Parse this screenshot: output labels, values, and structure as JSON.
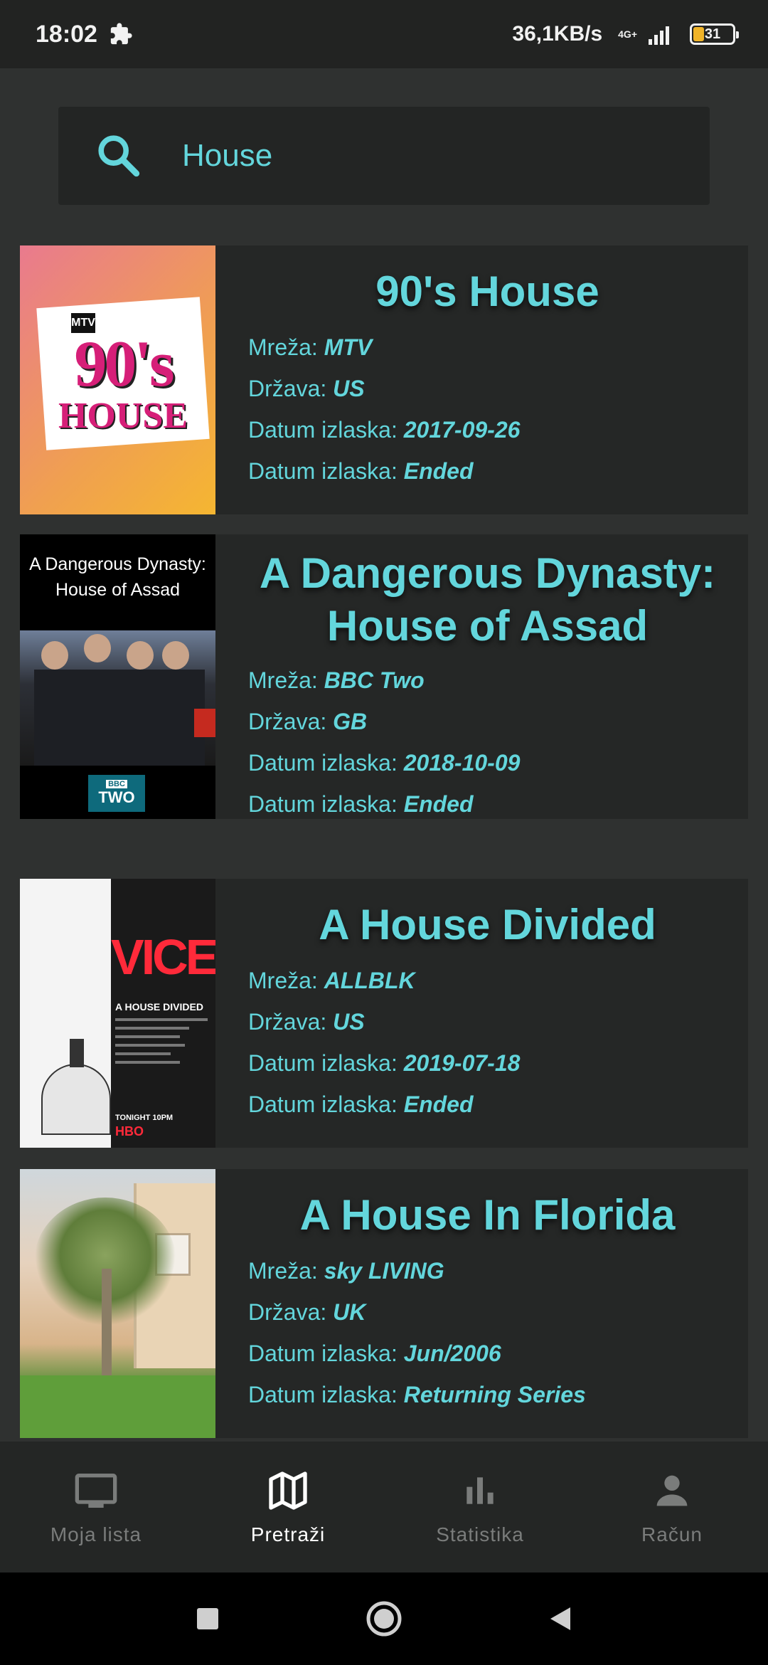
{
  "status": {
    "time": "18:02",
    "speed": "36,1KB/s",
    "net_type": "4G+",
    "battery": "31"
  },
  "search": {
    "value": "House",
    "placeholder": ""
  },
  "fields": {
    "network": "Mreža: ",
    "country": "Država: ",
    "release": "Datum izlaska: ",
    "status": "Datum izlaska: "
  },
  "shows": [
    {
      "title": "90's House",
      "network": "MTV",
      "country": "US",
      "release": "2017-09-26",
      "status": "Ended",
      "poster": {
        "line1": "90's",
        "line2": "HOUSE",
        "badge": "MTV"
      }
    },
    {
      "title": "A Dangerous Dynasty: House of Assad",
      "network": "BBC Two",
      "country": "GB",
      "release": "2018-10-09",
      "status": "Ended",
      "poster": {
        "caption": "A Dangerous Dynasty: House of Assad",
        "badge_top": "BBC",
        "badge_bottom": "TWO"
      }
    },
    {
      "title": "A House Divided",
      "network": "ALLBLK",
      "country": "US",
      "release": "2019-07-18",
      "status": "Ended",
      "poster": {
        "brand": "VICE",
        "sub": "A HOUSE DIVIDED",
        "bottom": "TONIGHT 10PM",
        "channel": "HBO"
      }
    },
    {
      "title": "A House In Florida",
      "network": "sky LIVING",
      "country": "UK",
      "release": "Jun/2006",
      "status": "Returning Series",
      "poster": {}
    }
  ],
  "nav": [
    {
      "label": "Moja lista",
      "icon": "tv-icon"
    },
    {
      "label": "Pretraži",
      "icon": "map-icon"
    },
    {
      "label": "Statistika",
      "icon": "bar-chart-icon"
    },
    {
      "label": "Račun",
      "icon": "person-icon"
    }
  ],
  "colors": {
    "accent": "#63d6dc",
    "background": "#2f3130",
    "card": "#252726"
  }
}
